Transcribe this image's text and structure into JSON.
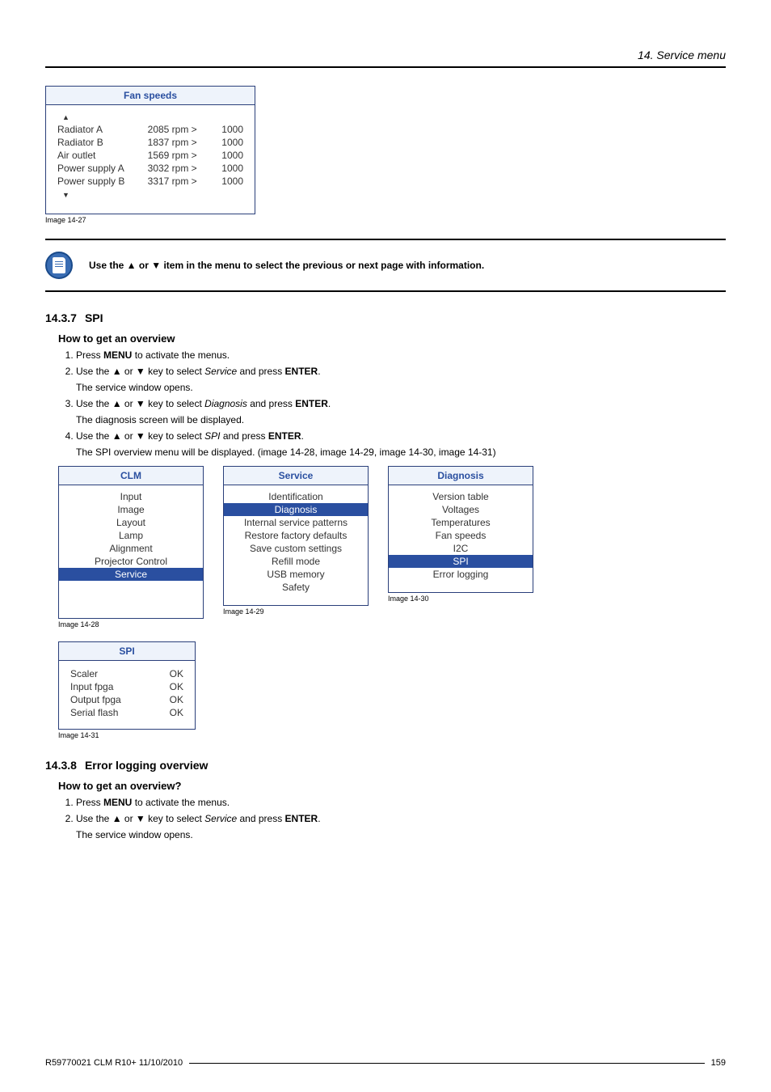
{
  "header": {
    "title": "14. Service menu"
  },
  "fanPanel": {
    "title": "Fan speeds",
    "rows": [
      {
        "name": "Radiator A",
        "value": "2085 rpm >",
        "limit": "1000"
      },
      {
        "name": "Radiator B",
        "value": "1837 rpm >",
        "limit": "1000"
      },
      {
        "name": "Air outlet",
        "value": "1569 rpm >",
        "limit": "1000"
      },
      {
        "name": "Power supply A",
        "value": "3032 rpm >",
        "limit": "1000"
      },
      {
        "name": "Power supply B",
        "value": "3317 rpm >",
        "limit": "1000"
      }
    ],
    "caption": "Image 14-27"
  },
  "note": "Use the ▲ or ▼ item in the menu to select the previous or next page with information.",
  "section1": {
    "num": "14.3.7",
    "title": "SPI",
    "sub": "How to get an overview",
    "steps": {
      "s1a": "Press ",
      "s1b": "MENU",
      "s1c": " to activate the menus.",
      "s2a": "Use the ▲ or ▼ key to select ",
      "s2b": "Service",
      "s2c": " and press ",
      "s2d": "ENTER",
      "s2e": ".",
      "s2sub": "The service window opens.",
      "s3a": "Use the ▲ or ▼ key to select ",
      "s3b": "Diagnosis",
      "s3c": " and press ",
      "s3d": "ENTER",
      "s3e": ".",
      "s3sub": "The diagnosis screen will be displayed.",
      "s4a": "Use the ▲ or ▼ key to select ",
      "s4b": "SPI",
      "s4c": " and press ",
      "s4d": "ENTER",
      "s4e": ".",
      "s4sub": "The SPI overview menu will be displayed. (image 14-28, image 14-29, image 14-30, image 14-31)"
    }
  },
  "clmPanel": {
    "title": "CLM",
    "items": [
      "Input",
      "Image",
      "Layout",
      "Lamp",
      "Alignment",
      "Projector Control"
    ],
    "selected": "Service",
    "caption": "Image 14-28"
  },
  "servicePanel": {
    "title": "Service",
    "items1": [
      "Identification"
    ],
    "selected": "Diagnosis",
    "items2": [
      "Internal service patterns",
      "Restore factory defaults",
      "Save custom settings",
      "Refill mode",
      "USB memory",
      "Safety"
    ],
    "caption": "Image 14-29"
  },
  "diagPanel": {
    "title": "Diagnosis",
    "items1": [
      "Version table",
      "Voltages",
      "Temperatures",
      "Fan speeds",
      "I2C"
    ],
    "selected": "SPI",
    "items2": [
      "Error logging"
    ],
    "caption": "Image 14-30"
  },
  "spiPanel": {
    "title": "SPI",
    "rows": [
      {
        "name": "Scaler",
        "status": "OK"
      },
      {
        "name": "Input fpga",
        "status": "OK"
      },
      {
        "name": "Output fpga",
        "status": "OK"
      },
      {
        "name": "Serial flash",
        "status": "OK"
      }
    ],
    "caption": "Image 14-31"
  },
  "section2": {
    "num": "14.3.8",
    "title": "Error logging overview",
    "sub": "How to get an overview?",
    "steps": {
      "s1a": "Press ",
      "s1b": "MENU",
      "s1c": " to activate the menus.",
      "s2a": "Use the ▲ or ▼ key to select ",
      "s2b": "Service",
      "s2c": " and press ",
      "s2d": "ENTER",
      "s2e": ".",
      "s2sub": "The service window opens."
    }
  },
  "footer": {
    "left": "R59770021 CLM R10+ 11/10/2010",
    "right": "159"
  }
}
